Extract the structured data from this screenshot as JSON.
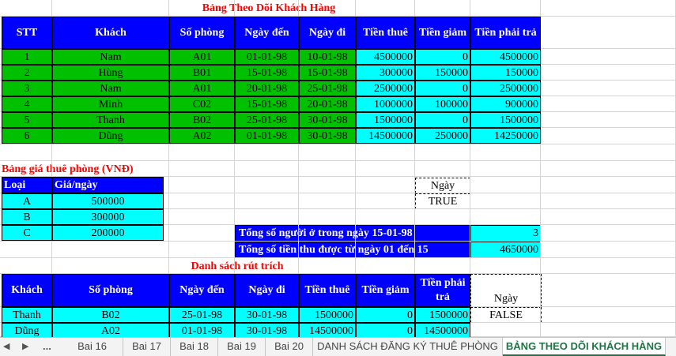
{
  "main_table": {
    "title": "Bảng Theo Dõi Khách Hàng",
    "headers": [
      "STT",
      "Khách",
      "Số phòng",
      "Ngày đến",
      "Ngày đi",
      "Tiền thuê",
      "Tiền giảm",
      "Tiền phải trả"
    ],
    "rows": [
      [
        "1",
        "Nam",
        "A01",
        "01-01-98",
        "10-01-98",
        "4500000",
        "0",
        "4500000"
      ],
      [
        "2",
        "Hùng",
        "B01",
        "15-01-98",
        "15-01-98",
        "300000",
        "150000",
        "150000"
      ],
      [
        "3",
        "Nam",
        "A01",
        "20-01-98",
        "25-01-98",
        "2500000",
        "0",
        "2500000"
      ],
      [
        "4",
        "Minh",
        "C02",
        "15-01-98",
        "20-01-98",
        "1000000",
        "100000",
        "900000"
      ],
      [
        "5",
        "Thanh",
        "B02",
        "25-01-98",
        "30-01-98",
        "1500000",
        "0",
        "1500000"
      ],
      [
        "6",
        "Dũng",
        "A02",
        "01-01-98",
        "30-01-98",
        "14500000",
        "250000",
        "14250000"
      ]
    ]
  },
  "price_table": {
    "title": "Bảng giá thuê phòng (VNĐ)",
    "headers": [
      "Loại",
      "Giá/ngày"
    ],
    "rows": [
      [
        "A",
        "500000"
      ],
      [
        "B",
        "300000"
      ],
      [
        "C",
        "200000"
      ]
    ]
  },
  "criteria1": {
    "header": "Ngày",
    "value": "TRUE"
  },
  "summary": {
    "label1": "Tổng số người ở trong ngày 15-01-98",
    "value1": "3",
    "label2": "Tổng số tiền thu được từ ngày 01 đến 15",
    "value2": "4650000"
  },
  "extract_table": {
    "title": "Danh sách rút trích",
    "headers": [
      "Khách",
      "Số phòng",
      "Ngày đến",
      "Ngày đi",
      "Tiền thuê",
      "Tiền giảm",
      "Tiền phải trả"
    ],
    "rows": [
      [
        "Thanh",
        "B02",
        "25-01-98",
        "30-01-98",
        "1500000",
        "0",
        "1500000"
      ],
      [
        "Dũng",
        "A02",
        "01-01-98",
        "30-01-98",
        "14500000",
        "0",
        "14500000"
      ]
    ]
  },
  "criteria2": {
    "header": "Ngày",
    "value": "FALSE"
  },
  "sheet_tabs": {
    "nav_prev": "◀",
    "nav_next": "▶",
    "more": "...",
    "tabs": [
      "Bai 16",
      "Bai 17",
      "Bai 18",
      "Bai 19",
      "Bai 20",
      "DANH SÁCH ĐĂNG KÝ THUÊ PHÒNG",
      "BẢNG THEO DÕI KHÁCH HÀNG"
    ],
    "active_index": 6
  },
  "colors": {
    "header_blue": "#0000ff",
    "green": "#00c000",
    "cyan": "#00ffff",
    "title_red": "#ff0000",
    "tab_active": "#217346"
  }
}
